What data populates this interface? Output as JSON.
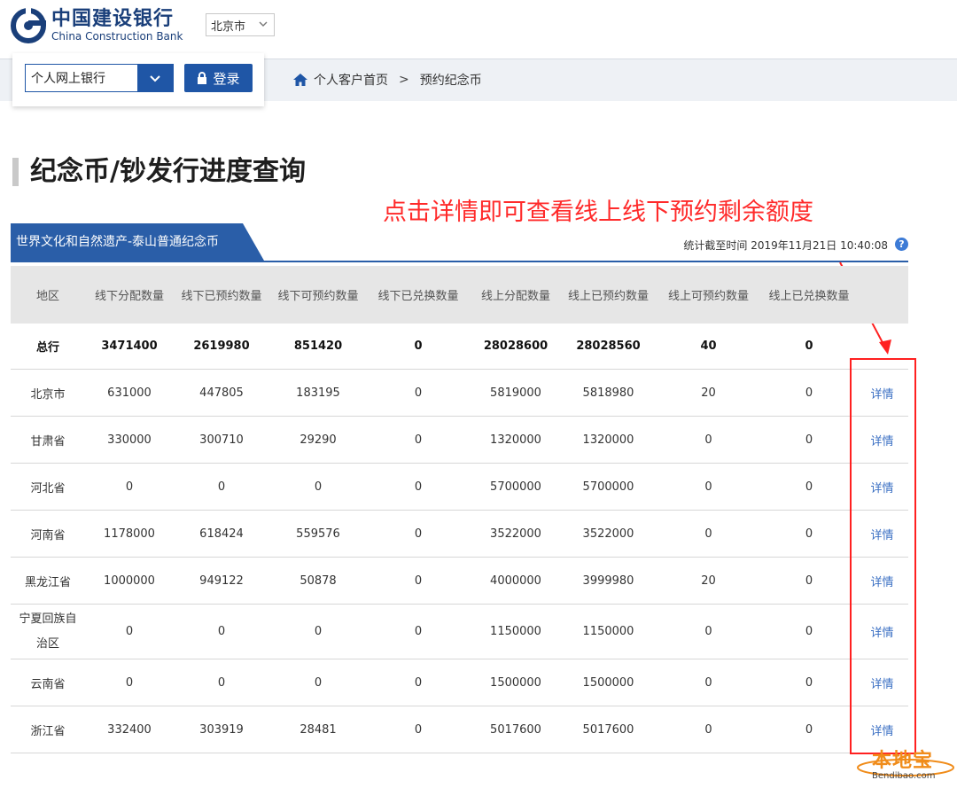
{
  "brand": {
    "name_cn": "中国建设银行",
    "name_en": "China Construction Bank",
    "logo_color": "#1a3f7a"
  },
  "city_select": {
    "value": "北京市",
    "icon": "chevron-down-icon"
  },
  "nav": {
    "bank_select_value": "个人网上银行",
    "login_label": "登录",
    "breadcrumb": [
      "个人客户首页",
      "预约纪念币"
    ],
    "accent_color": "#1f56a6"
  },
  "page_title": "纪念币/钞发行进度查询",
  "annotation": "点击详情即可查看线上线下预约剩余额度",
  "coin_tab": "世界文化和自然遗产-泰山普通纪念币",
  "timestamp": "统计截至时间 2019年11月21日 10:40:08",
  "table": {
    "headers": [
      "地区",
      "线下分配数量",
      "线下已预约数量",
      "线下可预约数量",
      "线下已兑换数量",
      "线上分配数量",
      "线上已预约数量",
      "线上可预约数量",
      "线上已兑换数量",
      ""
    ],
    "detail_label": "详情",
    "rows": [
      [
        "总行",
        "3471400",
        "2619980",
        "851420",
        "0",
        "28028600",
        "28028560",
        "40",
        "0",
        ""
      ],
      [
        "北京市",
        "631000",
        "447805",
        "183195",
        "0",
        "5819000",
        "5818980",
        "20",
        "0",
        "详情"
      ],
      [
        "甘肃省",
        "330000",
        "300710",
        "29290",
        "0",
        "1320000",
        "1320000",
        "0",
        "0",
        "详情"
      ],
      [
        "河北省",
        "0",
        "0",
        "0",
        "0",
        "5700000",
        "5700000",
        "0",
        "0",
        "详情"
      ],
      [
        "河南省",
        "1178000",
        "618424",
        "559576",
        "0",
        "3522000",
        "3522000",
        "0",
        "0",
        "详情"
      ],
      [
        "黑龙江省",
        "1000000",
        "949122",
        "50878",
        "0",
        "4000000",
        "3999980",
        "20",
        "0",
        "详情"
      ],
      [
        "宁夏回族自治区",
        "0",
        "0",
        "0",
        "0",
        "1150000",
        "1150000",
        "0",
        "0",
        "详情"
      ],
      [
        "云南省",
        "0",
        "0",
        "0",
        "0",
        "1500000",
        "1500000",
        "0",
        "0",
        "详情"
      ],
      [
        "浙江省",
        "332400",
        "303919",
        "28481",
        "0",
        "5017600",
        "5017600",
        "0",
        "0",
        "详情"
      ]
    ]
  },
  "watermark": {
    "text": "本地宝",
    "sub": "Bendibao.com"
  }
}
